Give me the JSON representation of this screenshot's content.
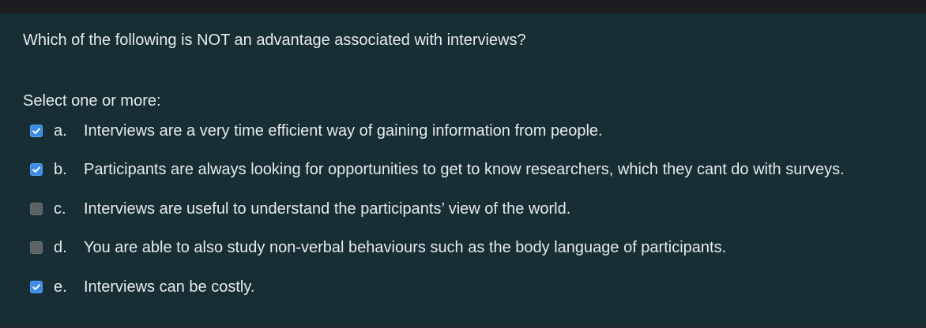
{
  "question": {
    "text": "Which of the following is NOT an advantage associated with interviews?",
    "prompt": "Select one or more:"
  },
  "options": [
    {
      "letter": "a.",
      "text": "Interviews are a very time efficient way of gaining information from people.",
      "checked": true
    },
    {
      "letter": "b.",
      "text": "Participants are always looking for opportunities to get to know researchers, which they cant do with surveys.",
      "checked": true
    },
    {
      "letter": "c.",
      "text": "Interviews are useful to understand the participants’ view of the world.",
      "checked": false
    },
    {
      "letter": "d.",
      "text": "You are able to also study non-verbal behaviours such as the body language of participants.",
      "checked": false
    },
    {
      "letter": "e.",
      "text": "Interviews can be costly.",
      "checked": true
    }
  ],
  "colors": {
    "background": "#172e34",
    "top_bar": "#1c1d20",
    "checkbox_checked": "#3c8ce8",
    "checkbox_unchecked": "#5d6365",
    "text": "#e6ebec"
  },
  "icons": {
    "checked": "checkmark-icon"
  }
}
